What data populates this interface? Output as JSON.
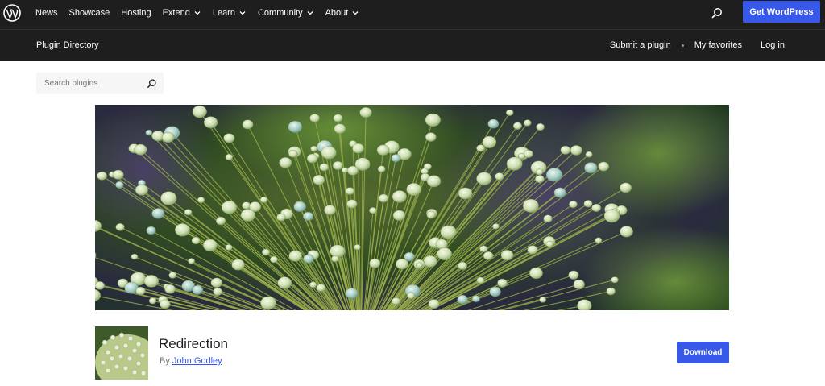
{
  "global_nav": {
    "items": [
      {
        "label": "News",
        "has_dropdown": false
      },
      {
        "label": "Showcase",
        "has_dropdown": false
      },
      {
        "label": "Hosting",
        "has_dropdown": false
      },
      {
        "label": "Extend",
        "has_dropdown": true
      },
      {
        "label": "Learn",
        "has_dropdown": true
      },
      {
        "label": "Community",
        "has_dropdown": true
      },
      {
        "label": "About",
        "has_dropdown": true
      }
    ],
    "cta_label": "Get WordPress"
  },
  "local_nav": {
    "title": "Plugin Directory",
    "links": [
      {
        "label": "Submit a plugin"
      },
      {
        "label": "My favorites"
      },
      {
        "label": "Log in"
      }
    ]
  },
  "search": {
    "placeholder": "Search plugins"
  },
  "plugin": {
    "name": "Redirection",
    "author_prefix": "By",
    "author_name": "John Godley",
    "download_label": "Download"
  },
  "colors": {
    "header_bg": "#1e1e1e",
    "accent": "#3858e9",
    "muted_text": "#757575"
  },
  "icons": [
    "wordpress-logo-icon",
    "search-icon",
    "chevron-down-icon"
  ]
}
